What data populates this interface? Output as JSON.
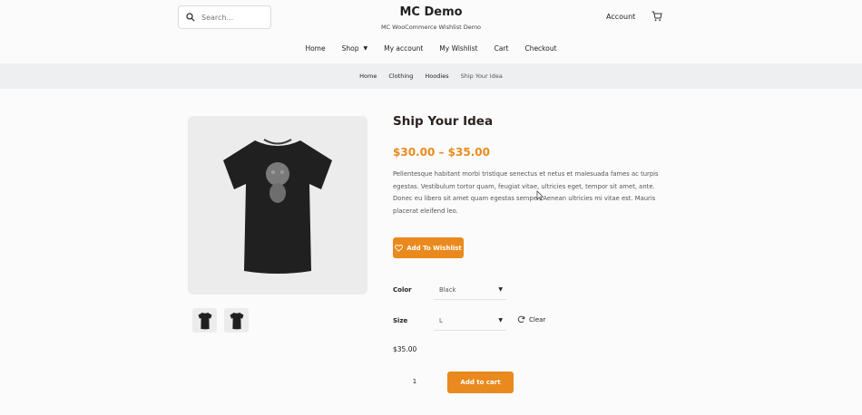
{
  "header": {
    "search_placeholder": "Search...",
    "site_title": "MC Demo",
    "tagline": "MC WooCommerce Wishlist Demo",
    "account_label": "Account"
  },
  "nav": {
    "items": [
      {
        "label": "Home"
      },
      {
        "label": "Shop"
      },
      {
        "label": "My account"
      },
      {
        "label": "My Wishlist"
      },
      {
        "label": "Cart"
      },
      {
        "label": "Checkout"
      }
    ]
  },
  "breadcrumb": [
    "Home",
    "Clothing",
    "Hoodies",
    "Ship Your Idea"
  ],
  "product": {
    "title": "Ship Your Idea",
    "price_range": "$30.00 – $35.00",
    "description": "Pellentesque habitant morbi tristique senectus et netus et malesuada fames ac turpis egestas. Vestibulum tortor quam, feugiat vitae, ultricies eget, tempor sit amet, ante. Donec eu libero sit amet quam egestas semper. Aenean ultricies mi vitae est. Mauris placerat eleifend leo.",
    "wishlist_label": "Add To Wishlist",
    "color_label": "Color",
    "color_value": "Black",
    "size_label": "Size",
    "size_value": "L",
    "clear_label": "Clear",
    "variation_price": "$35.00",
    "quantity": "1",
    "add_to_cart_label": "Add to cart"
  },
  "colors": {
    "accent": "#ea8a1e",
    "breadcrumb_bg": "#eeeff1",
    "image_bg": "#ececec"
  },
  "icons": [
    "search-icon",
    "cart-icon",
    "heart-icon",
    "refresh-icon",
    "chevron-down-icon",
    "tshirt-icon"
  ]
}
